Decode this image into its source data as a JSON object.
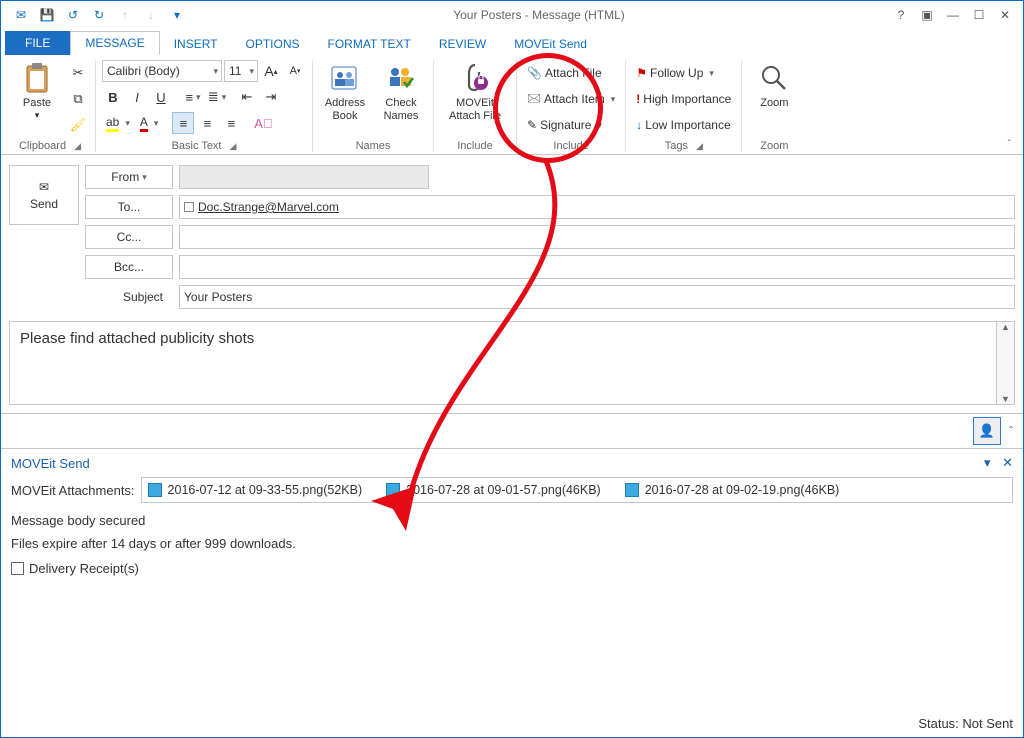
{
  "title": "Your Posters - Message (HTML)",
  "tabs": {
    "file": "FILE",
    "message": "MESSAGE",
    "insert": "INSERT",
    "options": "OPTIONS",
    "format_text": "FORMAT TEXT",
    "review": "REVIEW",
    "moveit_send": "MOVEit Send"
  },
  "ribbon": {
    "clipboard": {
      "paste": "Paste",
      "label": "Clipboard"
    },
    "basic_text": {
      "font_name": "Calibri (Body)",
      "font_size": "11",
      "label": "Basic Text"
    },
    "names": {
      "address_book": "Address\nBook",
      "check_names": "Check\nNames",
      "label": "Names"
    },
    "include_moveit": {
      "btn": "MOVEit\nAttach File",
      "label": "Include"
    },
    "include": {
      "attach_file": "Attach File",
      "attach_item": "Attach Item",
      "signature": "Signature",
      "label": "Include"
    },
    "tags": {
      "follow_up": "Follow Up",
      "high": "High Importance",
      "low": "Low Importance",
      "label": "Tags"
    },
    "zoom": {
      "btn": "Zoom",
      "label": "Zoom"
    }
  },
  "compose": {
    "send": "Send",
    "from_label": "From",
    "to_label": "To...",
    "cc_label": "Cc...",
    "bcc_label": "Bcc...",
    "subject_label": "Subject",
    "to_value": "Doc.Strange@Marvel.com",
    "subject_value": "Your Posters",
    "body": "Please find attached publicity shots"
  },
  "moveit": {
    "title": "MOVEit Send",
    "attachments_label": "MOVEit Attachments:",
    "attachments": [
      "2016-07-12 at 09-33-55.png(52KB)",
      "2016-07-28 at 09-01-57.png(46KB)",
      "2016-07-28 at 09-02-19.png(46KB)"
    ],
    "secured": "Message body secured",
    "expire": "Files expire after 14 days or after 999 downloads.",
    "delivery_receipt": "Delivery Receipt(s)",
    "status": "Status: Not Sent"
  }
}
